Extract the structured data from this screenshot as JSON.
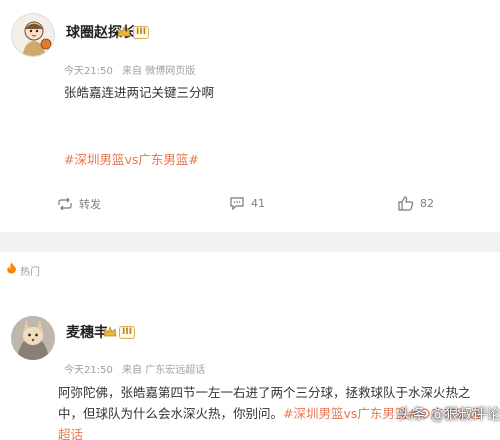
{
  "post1": {
    "username": "球圈赵探长",
    "vip_level": "III",
    "time": "今天21:50",
    "source": "来自 微博网页版",
    "text": "张皓嘉连进两记关键三分啊",
    "hashtag": "#深圳男篮vs广东男篮#",
    "actions": {
      "repost_label": "转发",
      "comment_count": "41",
      "like_count": "82"
    }
  },
  "hot_section": {
    "label": "热门"
  },
  "post2": {
    "username": "麦穗丰",
    "vip_level": "III",
    "time": "今天21:50",
    "source": "来自 广东宏远超话",
    "text": "阿弥陀佛，张皓嘉第四节一左一右进了两个三分球，拯救球队于水深火热之中，但球队为什么会水深火热，你别问。",
    "hashtag1": "#深圳男篮vs广东男篮#",
    "supertopic": "广东宏远超话"
  },
  "watermark": "头条 @狠叔评论",
  "colors": {
    "hashtag": "#eb7350",
    "meta": "#a0a0a0",
    "divider": "#f2f2f2"
  }
}
